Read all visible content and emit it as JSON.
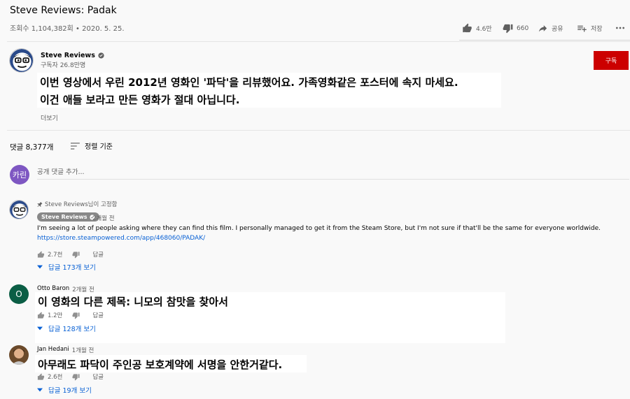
{
  "video": {
    "title": "Steve Reviews: Padak",
    "meta": "조회수 1,104,382회 • 2020. 5. 25."
  },
  "actions": {
    "likes": "4.6만",
    "dislikes": "660",
    "share": "공유",
    "save": "저장"
  },
  "channel": {
    "name": "Steve Reviews",
    "subs": "구독자 26.8만명",
    "subscribe": "구독"
  },
  "description": {
    "line1": "이번 영상에서 우린 2012년 영화인 '파닥'을 리뷰했어요. 가족영화같은 포스터에 속지 마세요.",
    "line2": "이건 애들 보라고 만든 영화가 절대 아닙니다.",
    "more": "더보기"
  },
  "comments_header": {
    "count": "댓글 8,377개",
    "sort": "정렬 기준"
  },
  "add_comment": {
    "avatar_text": "카린",
    "placeholder": "공개 댓글 추가..."
  },
  "comments": [
    {
      "pinned_by": "Steve Reviews님이 고정함",
      "author": "Steve Reviews",
      "time": "2개월 전",
      "text": "I'm seeing a lot of people asking where they can find this film. I personally managed to get it from the Steam Store, but I'm not sure if that'll be the same for everyone worldwide.",
      "link": "https://store.steampowered.com/app/468060/PADAK/",
      "likes": "2.7천",
      "reply": "답글",
      "replies": "답글 173개 보기"
    },
    {
      "author": "Otto Baron",
      "avatar_letter": "O",
      "time": "2개월 전",
      "text": "이 영화의 다른 제목: 니모의 참맛을 찾아서",
      "likes": "1.2만",
      "reply": "답글",
      "replies": "답글 128개 보기"
    },
    {
      "author": "Jan Hedani",
      "time": "1개월 전",
      "text": "아무래도 파닥이 주인공 보호계약에 서명을 안한거같다.",
      "likes": "2.6천",
      "reply": "답글",
      "replies": "답글 19개 보기"
    }
  ],
  "colors": {
    "subscribe_red": "#cc0000",
    "link_blue": "#065fd4",
    "otto_avatar": "#0b5e45",
    "user_avatar": "#7e57c2"
  }
}
